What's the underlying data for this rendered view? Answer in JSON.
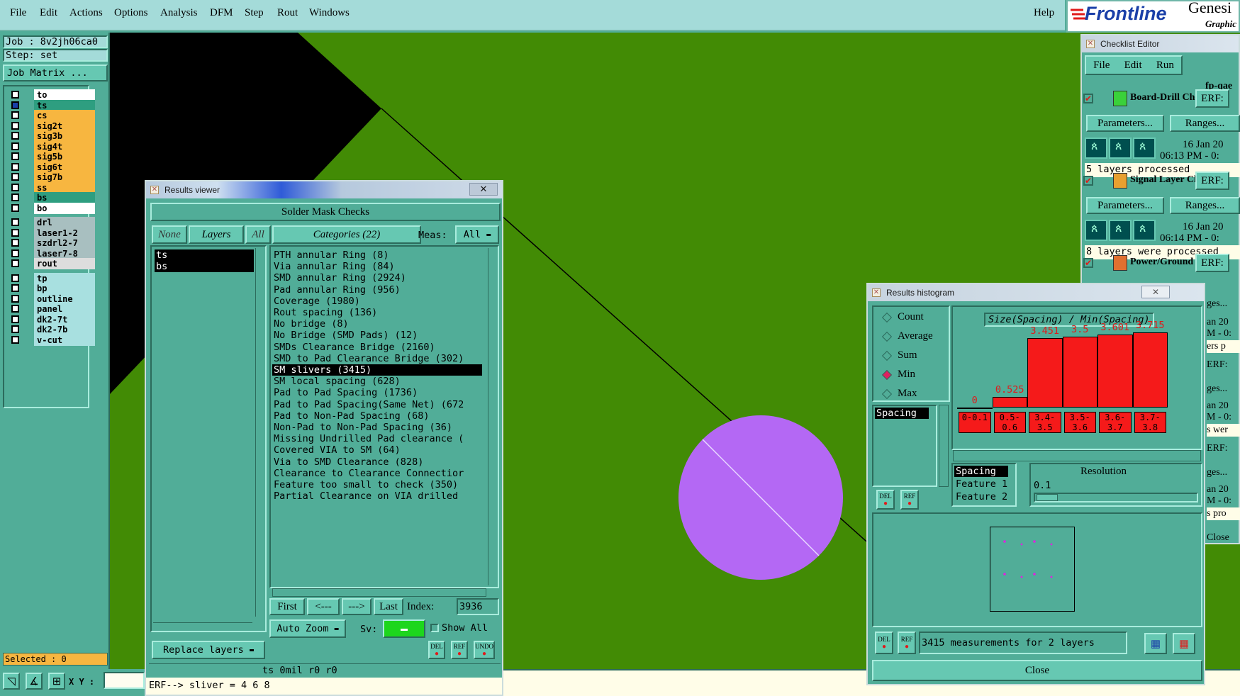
{
  "menubar": {
    "items": [
      "File",
      "Edit",
      "Actions",
      "Options",
      "Analysis",
      "DFM",
      "Step",
      "Rout",
      "Windows"
    ],
    "help": "Help"
  },
  "logo": {
    "brand": "Frontline",
    "product": "Genesi",
    "sub": "Graphic"
  },
  "left_panel": {
    "job": "Job : 8v2jh06ca0",
    "step": "Step: set",
    "job_matrix": "Job Matrix ...",
    "selected": "Selected : 0",
    "xy_label": "X Y :",
    "layer_groups": [
      [
        {
          "name": "to",
          "color": "#ffffff"
        },
        {
          "name": "ts",
          "color": "#2e9e80"
        },
        {
          "name": "cs",
          "color": "#f7b640"
        },
        {
          "name": "sig2t",
          "color": "#f7b640"
        },
        {
          "name": "sig3b",
          "color": "#f7b640"
        },
        {
          "name": "sig4t",
          "color": "#f7b640"
        },
        {
          "name": "sig5b",
          "color": "#f7b640"
        },
        {
          "name": "sig6t",
          "color": "#f7b640"
        },
        {
          "name": "sig7b",
          "color": "#f7b640"
        },
        {
          "name": "ss",
          "color": "#f7b640"
        },
        {
          "name": "bs",
          "color": "#2e9e80"
        },
        {
          "name": "bo",
          "color": "#ffffff"
        }
      ],
      [
        {
          "name": "drl",
          "color": "#a8bfc0"
        },
        {
          "name": "laser1-2",
          "color": "#a8bfc0"
        },
        {
          "name": "szdrl2-7",
          "color": "#a8bfc0"
        },
        {
          "name": "laser7-8",
          "color": "#a8bfc0"
        },
        {
          "name": "rout",
          "color": "#dddddd"
        }
      ],
      [
        {
          "name": "tp",
          "color": "#a8e0e0"
        },
        {
          "name": "bp",
          "color": "#a8e0e0"
        },
        {
          "name": "outline",
          "color": "#a8e0e0"
        },
        {
          "name": "panel",
          "color": "#a8e0e0"
        },
        {
          "name": "dk2-7t",
          "color": "#a8e0e0"
        },
        {
          "name": "dk2-7b",
          "color": "#a8e0e0"
        },
        {
          "name": "v-cut",
          "color": "#a8e0e0"
        }
      ]
    ]
  },
  "results_viewer": {
    "title": "Results viewer",
    "header": "Solder Mask Checks",
    "none": "None",
    "layers": "Layers",
    "all": "All",
    "categories": "Categories (22)",
    "meas_label": "Meas:",
    "meas_value": "All",
    "layer_list": [
      "ts",
      "bs"
    ],
    "category_list": [
      "PTH annular Ring (8)",
      "Via annular Ring (84)",
      "SMD annular Ring (2924)",
      "Pad annular Ring (956)",
      "Coverage (1980)",
      "Rout spacing (136)",
      "No bridge (8)",
      "No Bridge (SMD Pads) (12)",
      "SMDs Clearance Bridge (2160)",
      "SMD to Pad Clearance Bridge (302)",
      "SM slivers (3415)",
      "SM local spacing (628)",
      "Pad to Pad Spacing (1736)",
      "Pad to Pad Spacing(Same Net) (672",
      "Pad to Non-Pad Spacing (68)",
      "Non-Pad to Non-Pad Spacing (36)",
      "Missing Undrilled Pad clearance (",
      "Covered VIA to SM (64)",
      "Via to SMD Clearance (828)",
      "Clearance to Clearance Connectior",
      "Feature too small to check (350)",
      "Partial Clearance on VIA drilled"
    ],
    "selected_index": 10,
    "first": "First",
    "prev": "<---",
    "next": "--->",
    "last": "Last",
    "index_label": "Index:",
    "index_value": "3936",
    "auto_zoom": "Auto Zoom",
    "sv_label": "Sv:",
    "show_all": "Show All",
    "replace_layers": "Replace layers",
    "del": "DEL",
    "ref": "REF",
    "undo": "UNDO",
    "status": "ts 0mil  r0  r0",
    "erf": "ERF--> sliver = 4 6 8"
  },
  "histogram": {
    "title": "Results histogram",
    "modes": [
      "Count",
      "Average",
      "Sum",
      "Min",
      "Max"
    ],
    "selected_mode": "Min",
    "chart_title": "Size(Spacing) / Min(Spacing)",
    "measure_list": [
      "Spacing"
    ],
    "feature_list": [
      "Spacing",
      "Feature 1",
      "Feature 2"
    ],
    "resolution_label": "Resolution",
    "resolution_value": "0.1",
    "summary": "3415 measurements for 2 layers",
    "close": "Close",
    "del": "DEL",
    "ref": "REF"
  },
  "chart_data": {
    "type": "bar",
    "title": "Size(Spacing) / Min(Spacing)",
    "categories": [
      "0-0.1",
      "0.5-0.6",
      "3.4-3.5",
      "3.5-3.6",
      "3.6-3.7",
      "3.7-3.8"
    ],
    "value_labels": [
      "0",
      "0.525",
      "3.451",
      "3.5",
      "3.601",
      "3.715"
    ],
    "values": [
      0,
      0.525,
      3.451,
      3.5,
      3.601,
      3.715
    ],
    "ylim": [
      0,
      3.715
    ]
  },
  "checklist": {
    "title": "Checklist Editor",
    "menu": [
      "File",
      "Edit",
      "Run"
    ],
    "name": "fp-qae",
    "checks": [
      {
        "name": "Board-Drill Che",
        "erf": "ERF:",
        "params": "Parameters...",
        "ranges": "Ranges...",
        "date": "16 Jan 20",
        "time": "06:13 PM - 0:",
        "status": "5 layers processed"
      },
      {
        "name": "Signal Layer Ch",
        "erf": "ERF:",
        "params": "Parameters...",
        "ranges": "Ranges...",
        "date": "16 Jan 20",
        "time": "06:14 PM - 0:",
        "status": "8 layers were processed"
      },
      {
        "name": "Power/Ground C",
        "erf": "ERF:"
      }
    ],
    "peek": [
      "ges...",
      "an 20",
      "M - 0:",
      "ers p",
      "ERF:",
      "ges...",
      "an 20",
      "M - 0:",
      "s wer",
      "ERF:",
      "ges...",
      "an 20",
      "M - 0:",
      "s pro",
      "Close"
    ]
  }
}
